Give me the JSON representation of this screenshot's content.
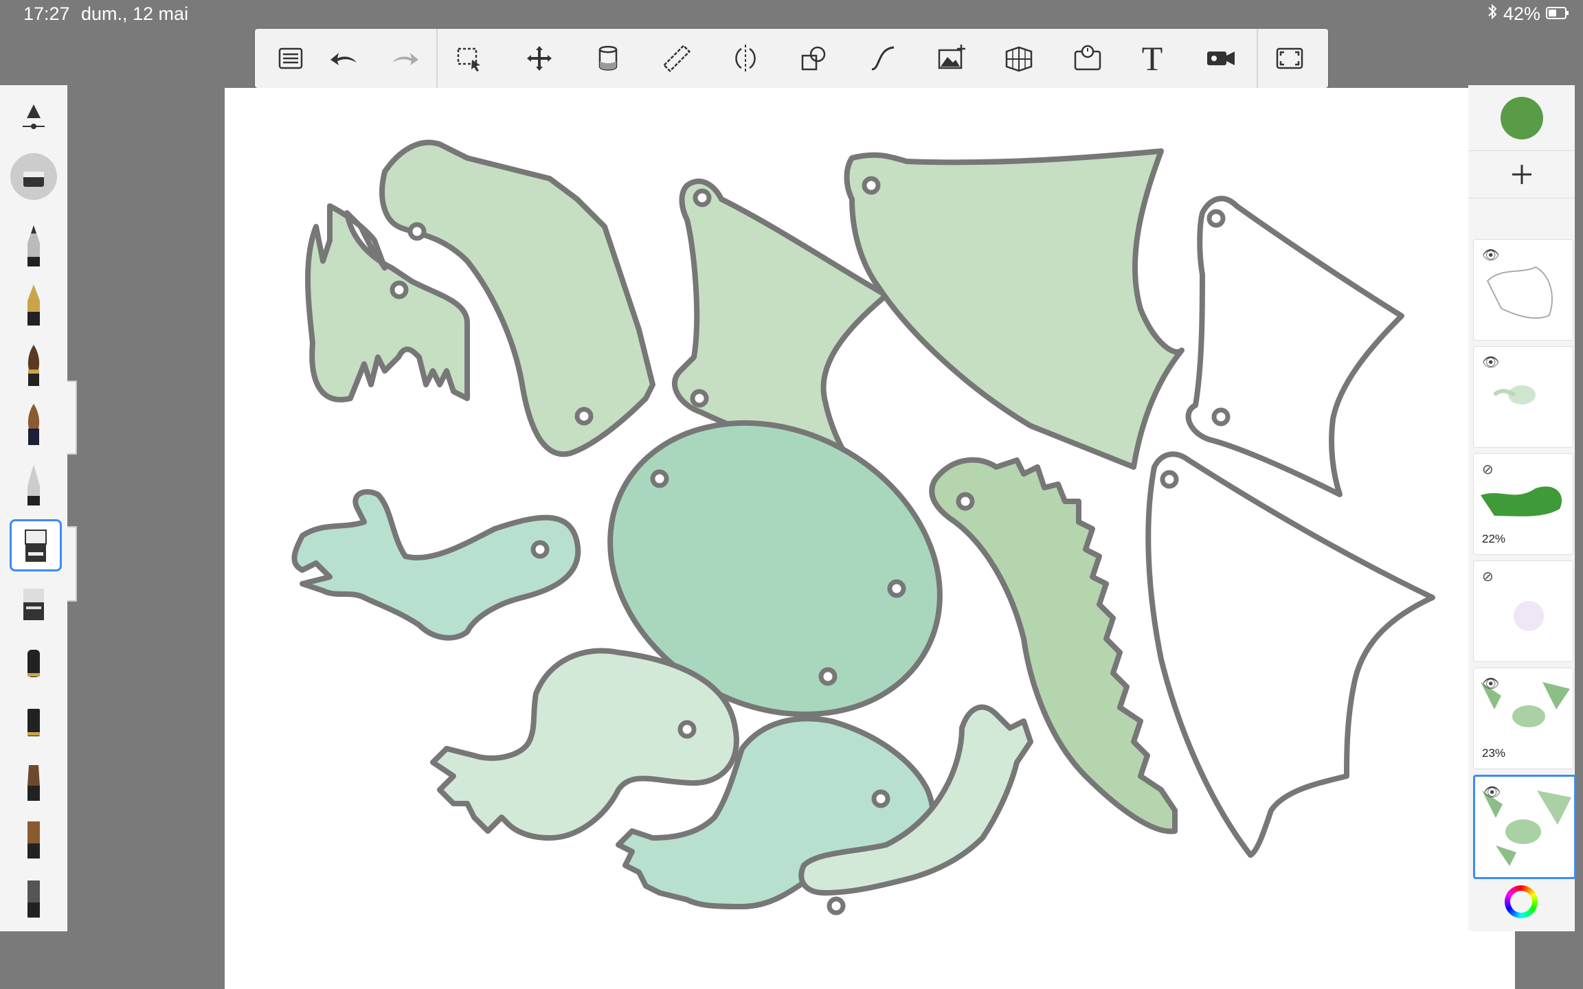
{
  "status": {
    "time": "17:27",
    "date": "dum., 12 mai",
    "battery": "42%",
    "bluetooth_icon": "bluetooth-icon"
  },
  "toolbar": {
    "text_tool_label": "T",
    "icons": [
      "menu-icon",
      "undo-icon",
      "redo-icon",
      "selection-icon",
      "transform-icon",
      "fill-icon",
      "ruler-icon",
      "symmetry-icon",
      "shape-icon",
      "curve-icon",
      "image-import-icon",
      "perspective-icon",
      "time-lapse-icon",
      "text-icon",
      "video-icon",
      "fullscreen-icon"
    ]
  },
  "colors": {
    "accent": "#3d8af7",
    "current_color": "#5a9b48",
    "outline": "#777777",
    "fill_green": "#c9e3c5",
    "fill_teal": "#a8dcc8"
  },
  "layers": [
    {
      "visible": true,
      "opacity_label": ""
    },
    {
      "visible": true,
      "opacity_label": ""
    },
    {
      "visible": false,
      "opacity_label": "22%"
    },
    {
      "visible": false,
      "opacity_label": ""
    },
    {
      "visible": true,
      "opacity_label": "23%"
    },
    {
      "visible": true,
      "opacity_label": "",
      "active": true
    }
  ],
  "brushes": [
    "brush-size-slider",
    "eraser-brush",
    "pencil-brush",
    "ink-pen-brush",
    "paint-brush",
    "ink-brush",
    "airbrush",
    "marker-brush",
    "chisel-marker-brush",
    "felt-pen-brush",
    "felt-pen-dark-brush",
    "bristle-brush",
    "wide-brush",
    "flat-brush"
  ]
}
